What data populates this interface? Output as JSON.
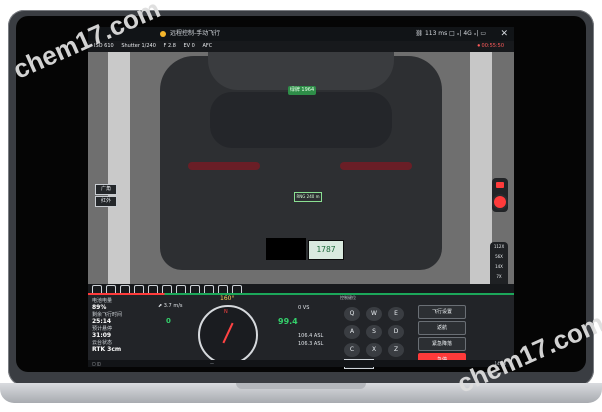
{
  "watermarks": {
    "left": "chem17.com",
    "right": "chem17.com"
  },
  "titlebar": {
    "title": "远程控制-手动飞行",
    "right": "⛓ 113 ms  □ ₓ| 4G ₓ| ▭",
    "close": "✕"
  },
  "status": {
    "items": [
      "ISO 610",
      "Shutter 1/240",
      "F 2.8",
      "EV 0",
      "AFC"
    ],
    "right": "⏺ 00:55:50"
  },
  "video": {
    "plate": "1787",
    "tag": "绿牌 1964",
    "center_readout": "RNG 240 m"
  },
  "side_buttons": {
    "wide": "广角",
    "ir": "红外"
  },
  "zoom": {
    "levels": [
      "112X",
      "56X",
      "14X",
      "7X",
      "2X",
      "1X"
    ]
  },
  "meta": {
    "battery_label": "电池电量",
    "battery": "89%",
    "flight_time_label": "剩余飞行时间",
    "flight_time": "25:14",
    "hover_label": "预计悬停",
    "hover": "31:09",
    "gimbal_label": "云台状态",
    "gimbal": "RTK 3cm"
  },
  "hud": {
    "heading": "160°",
    "speed": "⬈ 3.7 m/s",
    "speed2": "0",
    "vs": "0 VS",
    "alt": "99.4",
    "alt2": "106.4 ASL",
    "alt3": "106.3 ASL"
  },
  "keys": {
    "label": "控制键位",
    "q": "Q",
    "w": "W",
    "e": "E",
    "a": "A",
    "s": "S",
    "d": "D",
    "c": "C",
    "x": "X",
    "z": "Z"
  },
  "buttons": {
    "flight_settings": "飞行设置",
    "return": "返航",
    "emergency": "紧急降落",
    "takeoff": "急停",
    "back": "隐藏"
  },
  "taskbar": {
    "time": "14:40",
    "mid": "—"
  }
}
